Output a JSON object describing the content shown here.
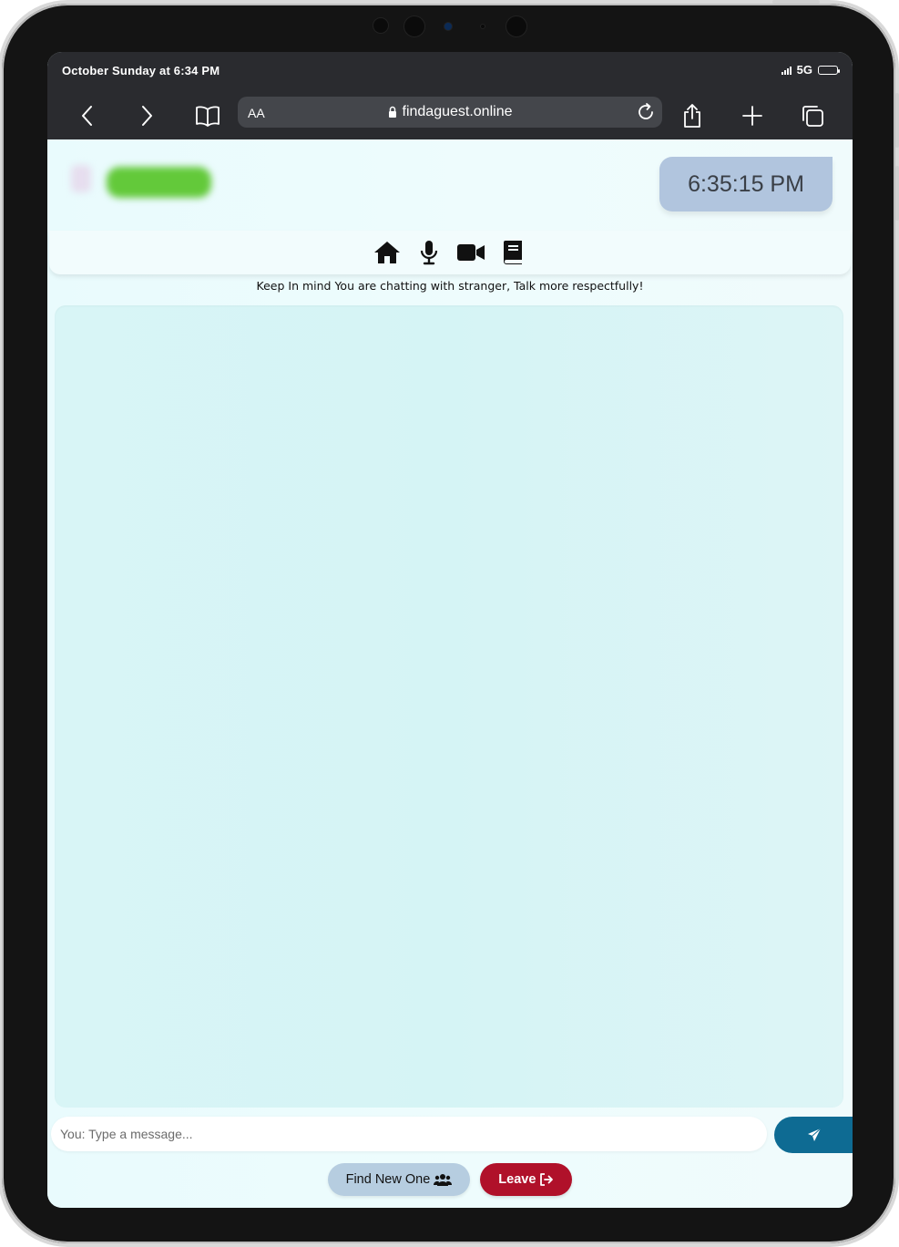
{
  "status_bar": {
    "datetime": "October Sunday at 6:34 PM",
    "network": "5G"
  },
  "browser": {
    "text_size_label": "AA",
    "url": "findaguest.online"
  },
  "header": {
    "clock": "6:35:15 PM"
  },
  "nav": {
    "items": [
      {
        "name": "home",
        "icon": "home-icon"
      },
      {
        "name": "voice",
        "icon": "microphone-icon"
      },
      {
        "name": "video",
        "icon": "video-camera-icon"
      },
      {
        "name": "book",
        "icon": "book-icon"
      }
    ]
  },
  "notice": "Keep In mind You are chatting with stranger, Talk more respectfully!",
  "composer": {
    "placeholder": "You: Type a message..."
  },
  "actions": {
    "find_new_label": "Find New One",
    "leave_label": "Leave"
  },
  "colors": {
    "accent_send": "#0e6b93",
    "leave_red": "#b0112a",
    "find_blue": "#b6cde0",
    "clock_bg": "#b1c5de",
    "logo_green": "#63c93a"
  }
}
